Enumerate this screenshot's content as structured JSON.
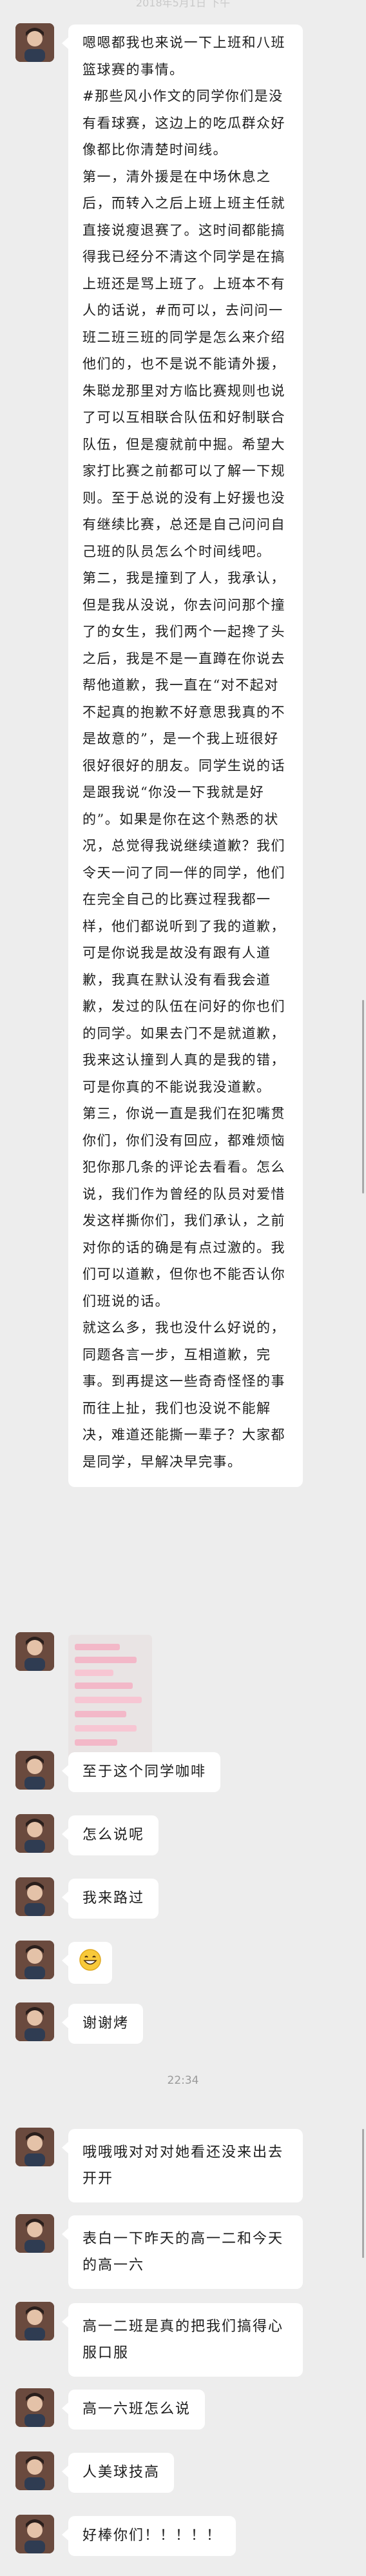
{
  "top_time": "2018年5月1日 下午",
  "messages": [
    {
      "type": "text",
      "paragraphs": [
        "嗯嗯都我也来说一下上班和八班篮球赛的事情。",
        "#那些风小作文的同学你们是没有看球赛，这边上的吃瓜群众好像都比你清楚时间线。",
        "第一，清外援是在中场休息之后，而转入之后上班上班主任就直接说瘦退赛了。这时间都能搞得我已经分不清这个同学是在搞上班还是骂上班了。上班本不有人的话说，#而可以，去问问一班二班三班的同学是怎么来介绍他们的，也不是说不能请外援，朱聪龙那里对方临比赛规则也说了可以互相联合队伍和好制联合队伍，但是瘦就前中掘。希望大家打比赛之前都可以了解一下规则。至于总说的没有上好援也没有继续比赛，总还是自己问问自己班的队员怎么个时间线吧。",
        "第二，我是撞到了人，我承认，但是我从没说，你去问问那个撞了的女生，我们两个一起搀了头之后，我是不是一直蹲在你说去帮他道歉，我一直在“对不起对不起真的抱歉不好意思我真的不是故意的”，是一个我上班很好很好很好的朋友。同学生说的话是跟我说“你没一下我就是好的”。如果是你在这个熟悉的状况，总觉得我说继续道歉？我们令天一问了同一伴的同学，他们在完全自己的比赛过程我都一样，他们都说听到了我的道歉，可是你说我是故没有跟有人道歉，我真在默认没有看我会道歉，发过的队伍在问好的你也们的同学。如果去门不是就道歉，我来这认撞到人真的是我的错，可是你真的不能说我没道歉。",
        "第三，你说一直是我们在犯嘴贯你们，你们没有回应，都难烦恼犯你那几条的评论去看看。怎么说，我们作为曾经的队员对爱惜发这样撕你们，我们承认，之前对你的话的确是有点过激的。我们可以道歉，但你也不能否认你们班说的话。",
        "就这么多，我也没什么好说的，同题各言一步，互相道歉，完事。到再提这一些奇奇怪怪的事而往上扯，我们也没说不能解决，难道还能撕一辈子？大家都是同学，早解决早完事。"
      ]
    },
    {
      "type": "image"
    },
    {
      "type": "text",
      "text": "至于这个同学咖啡"
    },
    {
      "type": "text",
      "text": "怎么说呢"
    },
    {
      "type": "text",
      "text": "我来路过"
    },
    {
      "type": "emoji",
      "text": "😁"
    },
    {
      "type": "text",
      "text": "谢谢烤"
    },
    {
      "type": "timestamp",
      "text": "22:34"
    },
    {
      "type": "text",
      "text": "哦哦哦对对对她看还没来出去开开"
    },
    {
      "type": "text",
      "text": "表白一下昨天的高一二和今天的高一六"
    },
    {
      "type": "text",
      "text": "高一二班是真的把我们搞得心服口服"
    },
    {
      "type": "text",
      "text": "高一六班怎么说"
    },
    {
      "type": "text",
      "text": "人美球技高"
    },
    {
      "type": "text",
      "text": "好棒你们！！！！！"
    }
  ],
  "colors": {
    "background": "#ededed",
    "bubble": "#ffffff",
    "avatar": "#5b3f36"
  },
  "icons": {
    "avatar": "user-avatar-photo"
  }
}
